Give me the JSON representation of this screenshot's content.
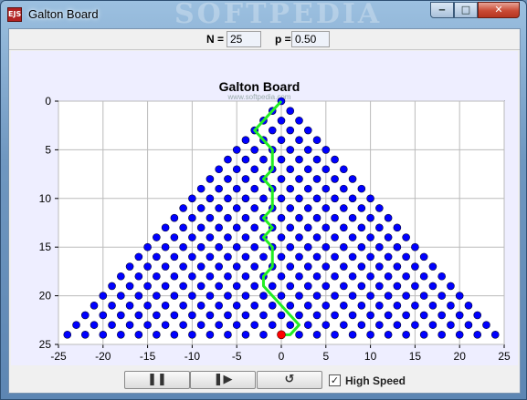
{
  "window": {
    "title": "Galton Board",
    "app_icon_text": "EJS",
    "watermark_text": "SOFTPEDIA",
    "controls": {
      "minimize": "‒",
      "maximize": "□",
      "close": "✕"
    }
  },
  "params": {
    "n_label": "N =",
    "n_value": "25",
    "p_label": "p =",
    "p_value": "0.50"
  },
  "plot": {
    "title": "Galton Board",
    "watermark": "www.softpedia.com",
    "background": "#ffffff",
    "grid_color": "#bbbbbb",
    "peg_color": "#0000ff",
    "path_color": "#22ee22",
    "ball_color": "#ff0000",
    "chart_data": {
      "type": "scatter",
      "title": "Galton Board",
      "xlim": [
        -25,
        25
      ],
      "ylim": [
        0,
        25
      ],
      "y_inverted": true,
      "grid": true,
      "x_ticks": [
        -25,
        -20,
        -15,
        -10,
        -5,
        0,
        5,
        10,
        15,
        20,
        25
      ],
      "y_ticks": [
        0,
        5,
        10,
        15,
        20,
        25
      ],
      "pegs": "triangular lattice: for each row y = 0..24, x from -y to y in steps of 2",
      "ball_path": {
        "x": [
          0,
          -1,
          -2,
          -3,
          -2,
          -1,
          -1,
          -1,
          -2,
          -1,
          -1,
          -1,
          -2,
          -1,
          -2,
          -1,
          -1,
          -1,
          -2,
          -2,
          -1,
          0,
          1,
          2,
          1,
          0
        ],
        "y": [
          0,
          1,
          2,
          3,
          4,
          5,
          6,
          7,
          8,
          9,
          10,
          11,
          12,
          13,
          14,
          15,
          16,
          17,
          18,
          19,
          20,
          21,
          22,
          23,
          24,
          24
        ]
      },
      "ball": {
        "x": 0,
        "y": 24
      }
    }
  },
  "controls": {
    "pause_icon": "❚❚",
    "step_icon": "❚▶",
    "reset_icon": "↺",
    "high_speed_checked": "✓",
    "high_speed_label": "High Speed"
  }
}
